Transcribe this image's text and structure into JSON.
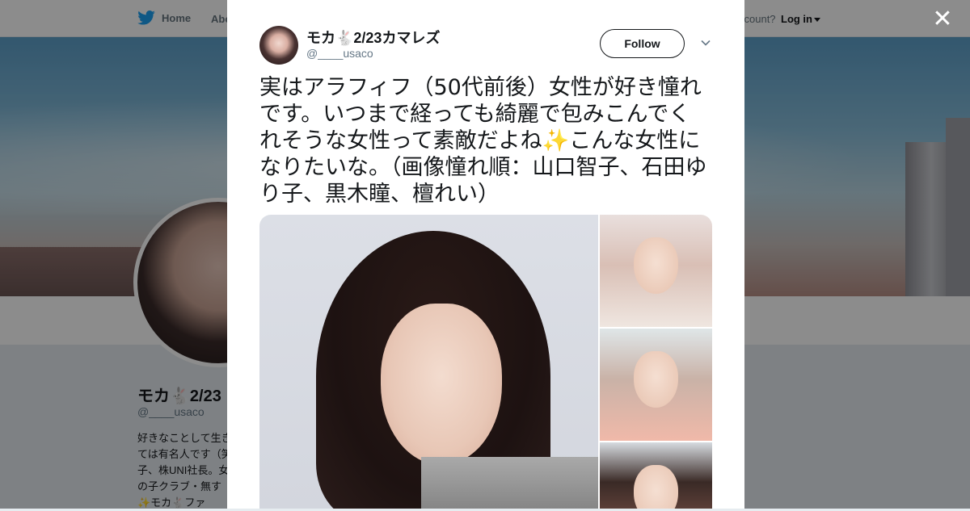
{
  "background": {
    "nav": {
      "home_label": "Home",
      "about_label": "Abo",
      "account_text": "ccount?",
      "login_label": "Log in"
    },
    "profile": {
      "name": "モカ🐇2/23",
      "handle": "@____usaco",
      "bio": "好きなことして生きては有名人です（笑子、株UNI社長。女の子クラブ・無す✨モカ🐇ファ"
    }
  },
  "tweet": {
    "author_name": "モカ🐇2/23カマレズ",
    "author_handle": "@____usaco",
    "follow_label": "Follow",
    "text": "実はアラフィフ（50代前後）女性が好き憧れです。いつまで経っても綺麗で包みこんでくれそうな女性って素敵だよね✨こんな女性になりたいな。（画像憧れ順：山口智子、石田ゆり子、黒木瞳、檀れい）",
    "media_count": 4
  },
  "colors": {
    "brand": "#1da1f2",
    "text_primary": "#14171a",
    "text_secondary": "#657786",
    "overlay": "rgba(0,0,0,0.45)"
  },
  "icons": {
    "brand": "bird-logo-icon",
    "close": "close-icon",
    "more": "chevron-down-icon"
  }
}
